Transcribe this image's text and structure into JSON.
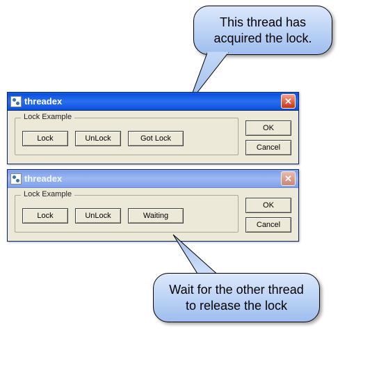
{
  "windows": {
    "top": {
      "title": "threadex",
      "group_label": "Lock Example",
      "buttons": {
        "lock": "Lock",
        "unlock": "UnLock",
        "status": "Got Lock"
      },
      "ok": "OK",
      "cancel": "Cancel"
    },
    "bottom": {
      "title": "threadex",
      "group_label": "Lock Example",
      "buttons": {
        "lock": "Lock",
        "unlock": "UnLock",
        "status": "Waiting"
      },
      "ok": "OK",
      "cancel": "Cancel"
    }
  },
  "callouts": {
    "top": "This thread has acquired the lock.",
    "bottom": "Wait for the other thread to release the lock"
  }
}
